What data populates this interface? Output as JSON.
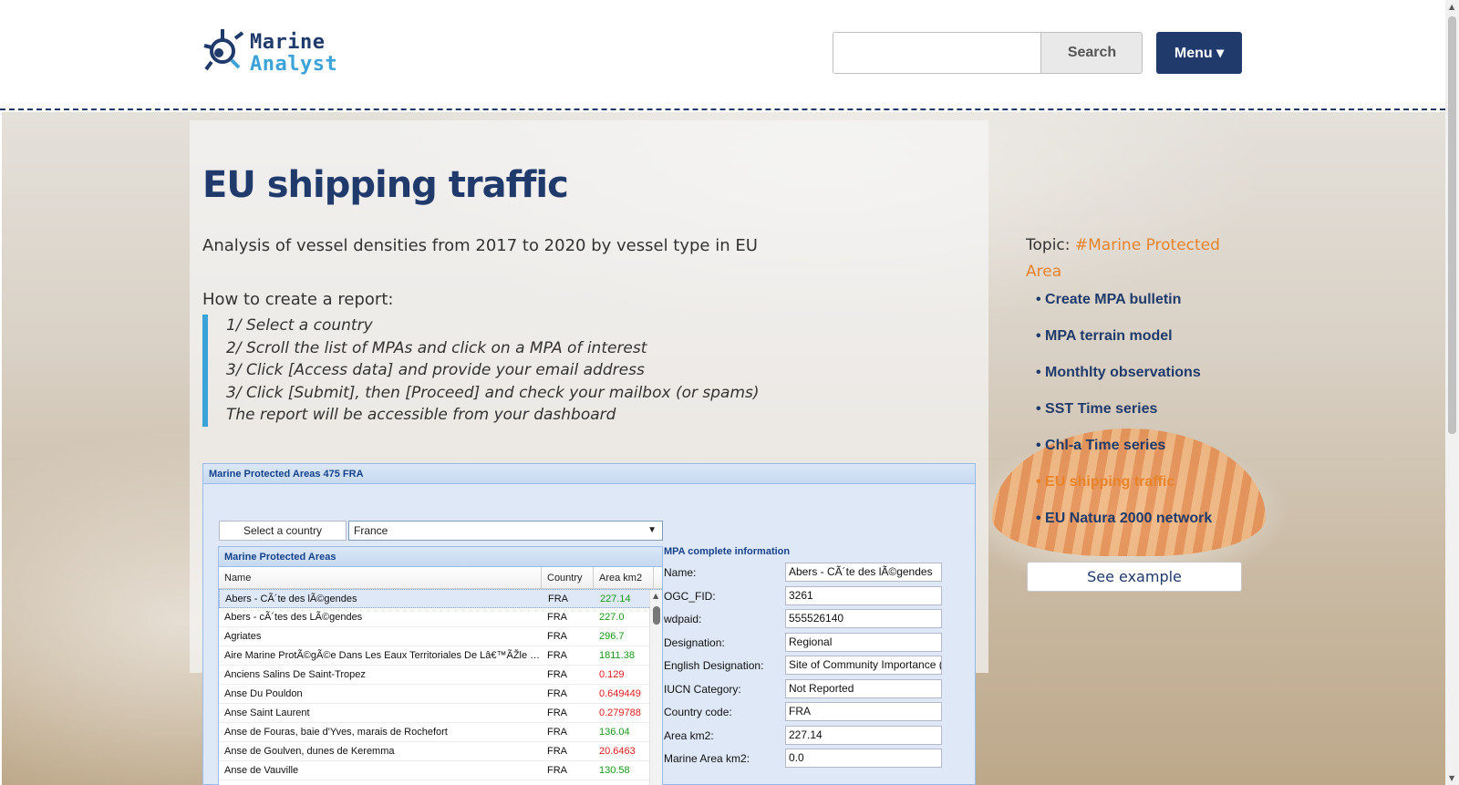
{
  "brand": {
    "name_line1": "Marine",
    "name_line2": "Analyst",
    "primary_color": "#1f3a6b",
    "accent_color": "#3ca3d9",
    "highlight_color": "#e8832a"
  },
  "header": {
    "search_value": "",
    "search_label": "Search",
    "menu_label": "Menu ▾"
  },
  "page": {
    "title": "EU shipping traffic",
    "subtitle": "Analysis of vessel densities from 2017 to 2020 by vessel type in EU",
    "howto_title": "How to create a report:",
    "steps": [
      "1/ Select a country",
      "2/ Scroll the list of MPAs and click on a MPA of interest",
      "3/ Click [Access data] and provide your email address",
      "3/ Click [Submit], then [Proceed] and check your mailbox (or spams)",
      "The report will be accessible from your dashboard"
    ]
  },
  "widget": {
    "title": "Marine Protected Areas 475 FRA",
    "country_label": "Select a country",
    "country_selected": "France",
    "grid_title": "Marine Protected Areas",
    "columns": [
      "Name",
      "Country",
      "Area km2"
    ],
    "rows": [
      {
        "name": "Abers - CÃ´te des lÃ©gendes",
        "country": "FRA",
        "area": "227.14",
        "status": "green"
      },
      {
        "name": "Abers - cÃ´tes des LÃ©gendes",
        "country": "FRA",
        "area": "227.0",
        "status": "green"
      },
      {
        "name": "Agriates",
        "country": "FRA",
        "area": "296.7",
        "status": "green"
      },
      {
        "name": "Aire Marine ProtÃ©gÃ©e Dans Les Eaux Territoriales De Lâ€™ÃŽle De La RÃ©union",
        "country": "FRA",
        "area": "1811.38",
        "status": "green"
      },
      {
        "name": "Anciens Salins De Saint-Tropez",
        "country": "FRA",
        "area": "0.129",
        "status": "red"
      },
      {
        "name": "Anse Du Pouldon",
        "country": "FRA",
        "area": "0.649449",
        "status": "red"
      },
      {
        "name": "Anse Saint Laurent",
        "country": "FRA",
        "area": "0.279788",
        "status": "red"
      },
      {
        "name": "Anse de Fouras, baie d'Yves, marais de Rochefort",
        "country": "FRA",
        "area": "136.04",
        "status": "green"
      },
      {
        "name": "Anse de Goulven, dunes de Keremma",
        "country": "FRA",
        "area": "20.6463",
        "status": "red"
      },
      {
        "name": "Anse de Vauville",
        "country": "FRA",
        "area": "130.58",
        "status": "green"
      }
    ],
    "info_title": "MPA complete information",
    "info": [
      {
        "label": "Name:",
        "value": "Abers - CÃ´te des lÃ©gendes"
      },
      {
        "label": "OGC_FID:",
        "value": "3261"
      },
      {
        "label": "wdpaid:",
        "value": "555526140"
      },
      {
        "label": "Designation:",
        "value": "Regional"
      },
      {
        "label": "English Designation:",
        "value": "Site of Community Importance ("
      },
      {
        "label": "IUCN Category:",
        "value": "Not Reported"
      },
      {
        "label": "Country code:",
        "value": "FRA"
      },
      {
        "label": "Area km2:",
        "value": "227.14"
      },
      {
        "label": "Marine Area km2:",
        "value": "0.0"
      }
    ]
  },
  "sidebar": {
    "topic_prefix": "Topic: ",
    "topic_tag": "#Marine Protected Area",
    "links": [
      {
        "label": "• Create MPA bulletin",
        "active": false
      },
      {
        "label": "• MPA terrain model",
        "active": false
      },
      {
        "label": "• Monthlty observations",
        "active": false
      },
      {
        "label": "• SST Time series",
        "active": false
      },
      {
        "label": "• Chl-a Time series",
        "active": false
      },
      {
        "label": "• EU shipping traffic",
        "active": true
      },
      {
        "label": "• EU Natura 2000 network",
        "active": false
      }
    ],
    "example_label": "See example"
  }
}
